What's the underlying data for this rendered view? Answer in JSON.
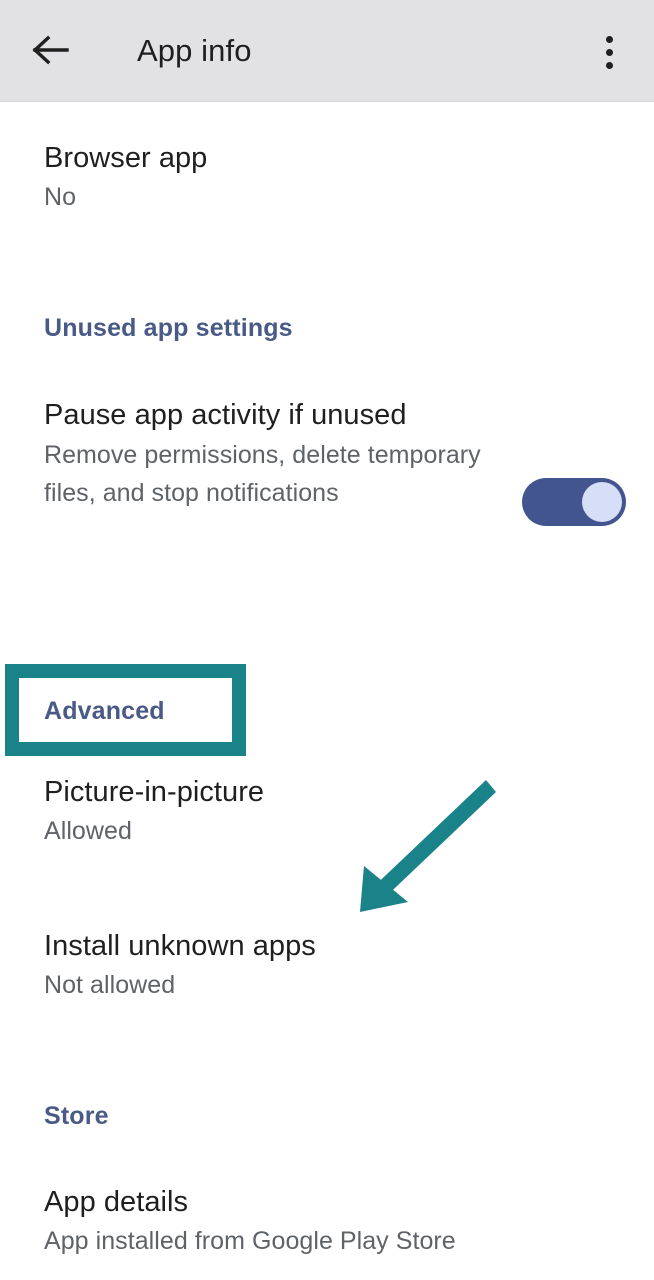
{
  "appbar": {
    "title": "App info",
    "back_icon": "arrow-left-icon",
    "overflow_icon": "more-vertical-icon"
  },
  "rows": {
    "browser_app": {
      "title": "Browser app",
      "value": "No"
    },
    "pause_app_activity": {
      "title": "Pause app activity if unused",
      "description": "Remove permissions, delete temporary files, and stop notifications",
      "toggle_state": "on"
    },
    "picture_in_picture": {
      "title": "Picture-in-picture",
      "value": "Allowed"
    },
    "install_unknown_apps": {
      "title": "Install unknown apps",
      "value": "Not allowed"
    },
    "app_details": {
      "title": "App details",
      "value": "App installed from Google Play Store"
    }
  },
  "sections": {
    "unused_app_settings": "Unused app settings",
    "advanced": "Advanced",
    "store": "Store"
  },
  "annotations": {
    "highlight_color": "#1a8289",
    "arrow_color": "#1a8289",
    "highlight_target": "Advanced",
    "arrow_target": "Install unknown apps"
  },
  "colors": {
    "appbar_background": "#e2e2e5",
    "section_header": "#4a5a87",
    "primary_text": "#1f1f1f",
    "secondary_text": "#5f6368",
    "toggle_track": "#42558f",
    "toggle_thumb": "#d6dff7"
  }
}
